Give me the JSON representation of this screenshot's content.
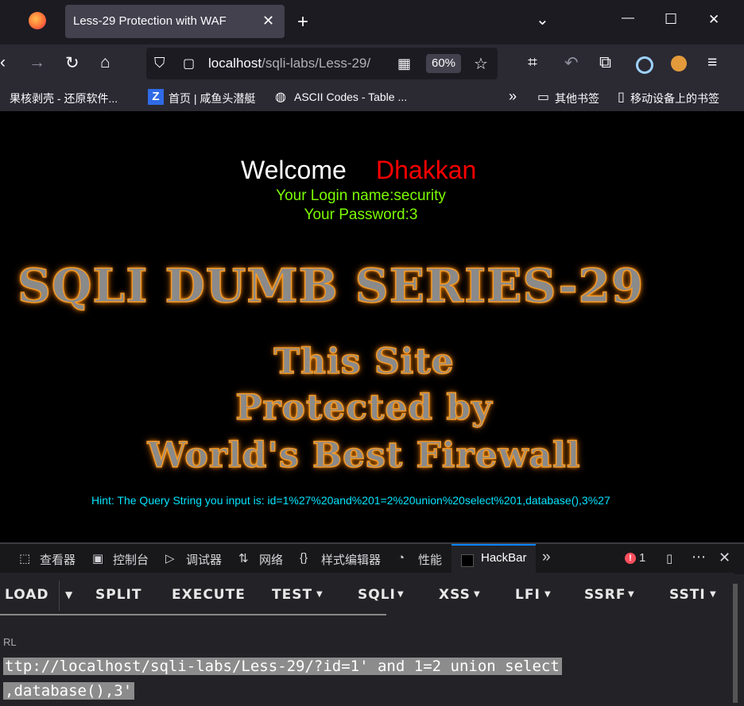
{
  "tab": {
    "title": "Less-29 Protection with WAF",
    "close": "✕",
    "new": "+"
  },
  "window": {
    "list_all": "⌄",
    "minimize": "—",
    "maximize": "☐",
    "close": "✕"
  },
  "nav": {
    "url_host": "localhost",
    "url_path": "/sqli-labs/Less-29/",
    "zoom": "60%"
  },
  "bookmarks": [
    "果核剥壳 - 还原软件...",
    "首页 | 咸鱼头潜艇",
    "ASCII Codes - Table ...",
    "其他书签",
    "移动设备上的书签"
  ],
  "page": {
    "welcome": "Welcome",
    "name": "Dhakkan",
    "login": "Your Login name:security",
    "password": "Your Password:3",
    "banner_title": "SQLI DUMB SERIES-29",
    "banner_line1": "This Site",
    "banner_line2": "Protected by",
    "banner_line3": "World's Best Firewall",
    "hint": "Hint: The Query String you input is: id=1%27%20and%201=2%20union%20select%201,database(),3%27"
  },
  "devtools": {
    "tabs": [
      "查看器",
      "控制台",
      "调试器",
      "网络",
      "样式编辑器",
      "性能",
      "HackBar"
    ],
    "error_count": "1",
    "hackbar": {
      "buttons": [
        "LOAD",
        "SPLIT",
        "EXECUTE",
        "TEST",
        "SQLI",
        "XSS",
        "LFI",
        "SSRF",
        "SSTI"
      ],
      "url_label": "RL",
      "url_line1": "ttp://localhost/sqli-labs/Less-29/?id=1' and 1=2 union select",
      "url_line2": ",database(),3'"
    }
  },
  "colors": {
    "accent": "#0a84ff",
    "welcome_name": "#ff0000",
    "login_text": "#7cfc00",
    "hint_text": "#00e5ff"
  }
}
